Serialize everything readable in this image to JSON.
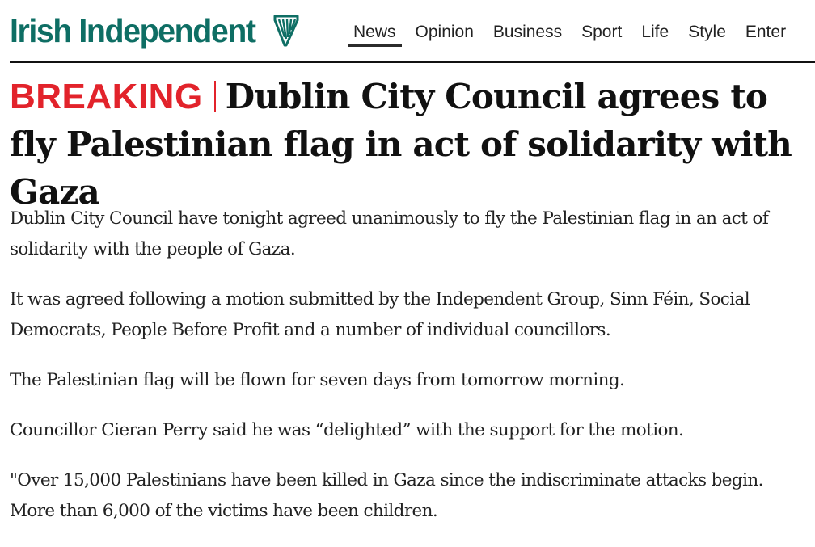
{
  "masthead": {
    "logo_text": "Irish Independent",
    "logo_icon": "harp-icon",
    "brand_color": "#0e6e64"
  },
  "nav": {
    "items": [
      {
        "label": "News",
        "active": true
      },
      {
        "label": "Opinion",
        "active": false
      },
      {
        "label": "Business",
        "active": false
      },
      {
        "label": "Sport",
        "active": false
      },
      {
        "label": "Life",
        "active": false
      },
      {
        "label": "Style",
        "active": false
      },
      {
        "label": "Enter",
        "active": false
      }
    ]
  },
  "article": {
    "breaking_label": "BREAKING",
    "breaking_color": "#e2232b",
    "headline": "Dublin City Council agrees to fly Palestinian flag in act of solidarity with Gaza",
    "paragraphs": [
      "Dublin City Council have tonight agreed unanimously to fly the Palestinian flag in an act of solidarity with the people of Gaza.",
      "It was agreed following a motion submitted by the Independent Group, Sinn Féin, Social Democrats, People Before Profit and a number of individual councillors.",
      "The Palestinian flag will be flown for seven days from tomorrow morning.",
      "Councillor Cieran Perry said he was “delighted” with the support for the motion.",
      "\"Over 15,000 Palestinians have been killed in Gaza since the indiscriminate attacks begin. More than 6,000 of the victims have been children."
    ]
  }
}
